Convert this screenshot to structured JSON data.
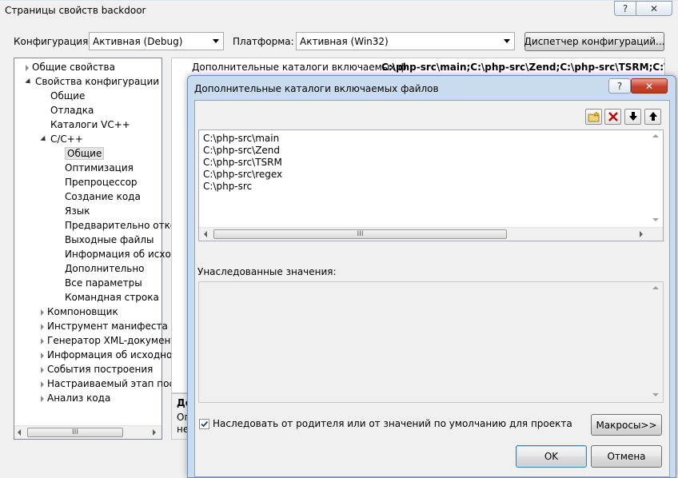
{
  "window": {
    "title": "Страницы свойств backdoor",
    "help_glyph": "?",
    "close_glyph": "✕"
  },
  "toolbar": {
    "config_label": "Конфигурация:",
    "config_value": "Активная (Debug)",
    "platform_label": "Платформа:",
    "platform_value": "Активная (Win32)",
    "config_manager_button": "Диспетчер конфигураций..."
  },
  "tree": {
    "items": [
      {
        "label": "Общие свойства"
      },
      {
        "label": "Свойства конфигурации"
      },
      {
        "label": "Общие"
      },
      {
        "label": "Отладка"
      },
      {
        "label": "Каталоги VC++"
      },
      {
        "label": "C/C++"
      },
      {
        "label": "Общие"
      },
      {
        "label": "Оптимизация"
      },
      {
        "label": "Препроцессор"
      },
      {
        "label": "Создание кода"
      },
      {
        "label": "Язык"
      },
      {
        "label": "Предварительно отко"
      },
      {
        "label": "Выходные файлы"
      },
      {
        "label": "Информация об исход"
      },
      {
        "label": "Дополнительно"
      },
      {
        "label": "Все параметры"
      },
      {
        "label": "Командная строка"
      },
      {
        "label": "Компоновщик"
      },
      {
        "label": "Инструмент манифеста"
      },
      {
        "label": "Генератор XML-документ"
      },
      {
        "label": "Информация об исходно"
      },
      {
        "label": "События построения"
      },
      {
        "label": "Настраиваемый этап пос"
      },
      {
        "label": "Анализ кода"
      }
    ],
    "scroll_thumb": "III"
  },
  "property_row": {
    "name": "Дополнительные каталоги включаемых ф",
    "value": "C:\\php-src\\main;C:\\php-src\\Zend;C:\\php-src\\TSRM;C:\\php-src\\re"
  },
  "description": {
    "title": "До",
    "line1": "Оп",
    "line2": "не"
  },
  "dialog": {
    "title": "Дополнительные каталоги включаемых файлов",
    "help_glyph": "?",
    "close_glyph": "✕",
    "paths": [
      "C:\\php-src\\main",
      "C:\\php-src\\Zend",
      "C:\\php-src\\TSRM",
      "C:\\php-src\\regex",
      "C:\\php-src"
    ],
    "scroll_thumb": "III",
    "inherited_label": "Унаследованные значения:",
    "inherit_checkbox_label": "Наследовать от родителя или от значений по умолчанию для проекта",
    "inherit_checked": true,
    "macros_button": "Макросы>>",
    "ok_button": "OK",
    "cancel_button": "Отмена"
  },
  "colors": {
    "dialog_frame": "#c9dbef",
    "delete_icon": "#c00000"
  }
}
